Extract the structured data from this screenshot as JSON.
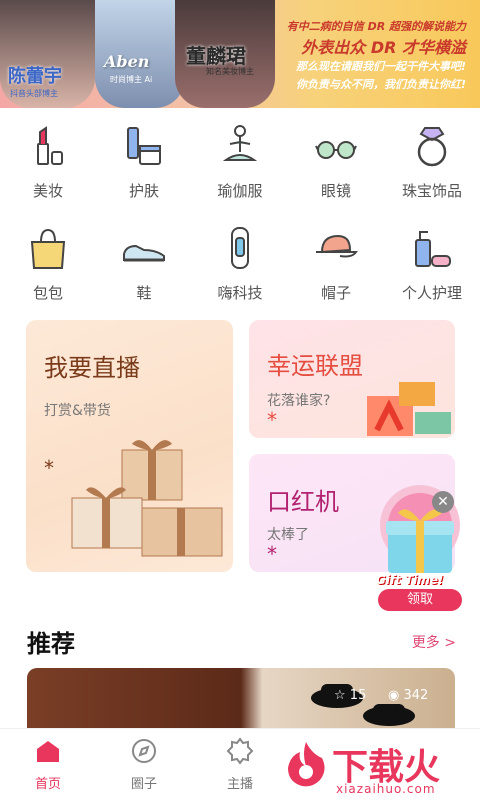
{
  "banner": {
    "person1": {
      "name": "陈蕾宇",
      "subtitle": "抖音头部博主"
    },
    "person2": {
      "name": "Aben",
      "subtitle": "时尚博主 Ai"
    },
    "person3": {
      "name": "董麟珺",
      "subtitle": "知名美妆博主"
    },
    "slogan_line1": "有中二病的自信 DR 超强的解说能力",
    "slogan_line2": "外表出众 DR 才华横溢",
    "slogan_line3": "那么现在请跟我们一起干件大事吧!",
    "slogan_line4": "你负责与众不同，我们负责让你红!"
  },
  "categories": [
    {
      "label": "美妆",
      "icon": "lipstick-icon"
    },
    {
      "label": "护肤",
      "icon": "skincare-icon"
    },
    {
      "label": "瑜伽服",
      "icon": "yoga-icon"
    },
    {
      "label": "眼镜",
      "icon": "glasses-icon"
    },
    {
      "label": "珠宝饰品",
      "icon": "ring-icon"
    },
    {
      "label": "包包",
      "icon": "bag-icon"
    },
    {
      "label": "鞋",
      "icon": "shoe-icon"
    },
    {
      "label": "嗨科技",
      "icon": "smartband-icon"
    },
    {
      "label": "帽子",
      "icon": "hat-icon"
    },
    {
      "label": "个人护理",
      "icon": "personal-care-icon"
    }
  ],
  "promos": {
    "live": {
      "title": "我要直播",
      "desc": "打赏&带货",
      "star": "*"
    },
    "luck": {
      "title": "幸运联盟",
      "desc": "花落谁家?",
      "star": "*"
    },
    "lip": {
      "title": "口红机",
      "desc": "太棒了",
      "star": "*"
    }
  },
  "gift": {
    "label": "Gift Time!",
    "button": "领取",
    "close": "✕"
  },
  "recommend": {
    "title": "推荐",
    "more": "更多 >",
    "stars": "15",
    "views": "342"
  },
  "nav": [
    {
      "label": "首页",
      "icon": "home-icon",
      "active": true
    },
    {
      "label": "圈子",
      "icon": "compass-icon",
      "active": false
    },
    {
      "label": "主播",
      "icon": "anchor-badge-icon",
      "active": false
    }
  ],
  "watermark": {
    "main": "下载火",
    "sub": "xiazaihuo.com"
  },
  "colors": {
    "accent": "#e8365d",
    "live_title": "#7a3b1a",
    "luck_title": "#e44d40",
    "lip_title": "#b1216f"
  }
}
